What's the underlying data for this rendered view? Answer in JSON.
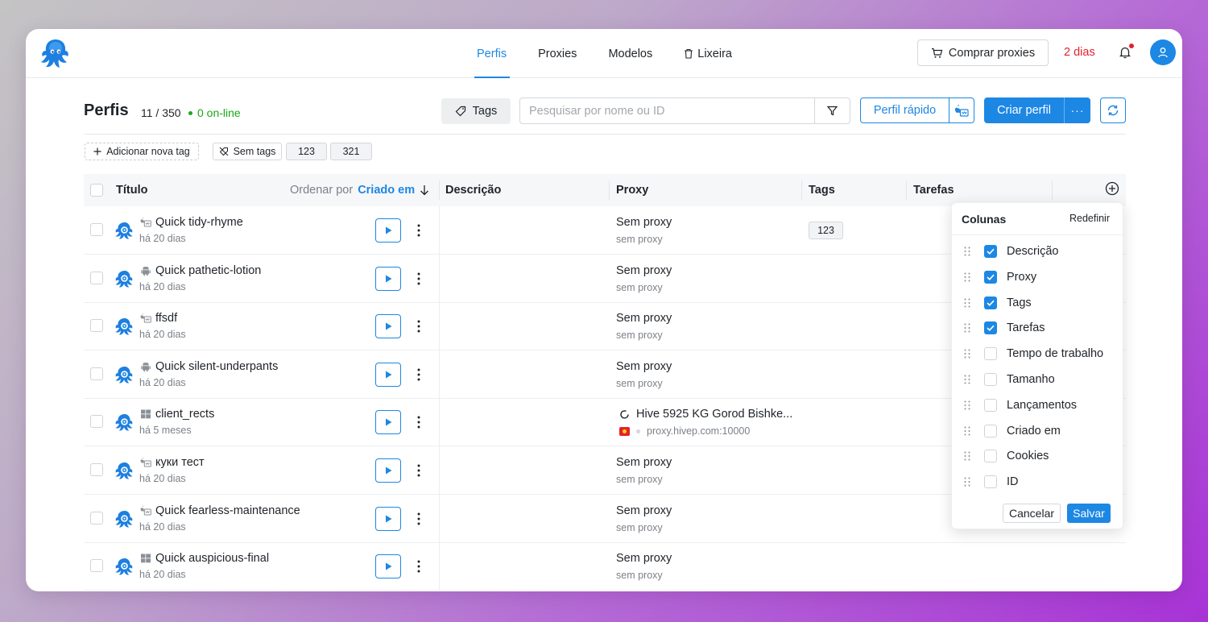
{
  "nav": {
    "items": [
      "Perfis",
      "Proxies",
      "Modelos",
      "Lixeira"
    ],
    "active": "Perfis",
    "buy_label": "Comprar proxies",
    "days_left": "2 dias"
  },
  "header": {
    "title": "Perfis",
    "count": "11 / 350",
    "online": "0 on-line",
    "tags_label": "Tags",
    "search_placeholder": "Pesquisar por nome ou ID",
    "quick_profile_label": "Perfil rápido",
    "create_label": "Criar perfil",
    "create_more": "···"
  },
  "tag_filters": {
    "add_label": "Adicionar nova tag",
    "no_tags_label": "Sem tags",
    "tags": [
      "123",
      "321"
    ]
  },
  "table": {
    "columns": {
      "title": "Título",
      "sort_prefix": "Ordenar por",
      "sort_value": "Criado em",
      "description": "Descrição",
      "proxy": "Proxy",
      "tags": "Tags",
      "tasks": "Tarefas"
    },
    "rows": [
      {
        "title": "Quick tidy-rhyme",
        "created": "há 20 dias",
        "os": "macos-icon",
        "proxy": "Sem proxy",
        "proxy_sub": "sem proxy",
        "tag": "123"
      },
      {
        "title": "Quick pathetic-lotion",
        "created": "há 20 dias",
        "os": "android-icon",
        "proxy": "Sem proxy",
        "proxy_sub": "sem proxy",
        "tag": ""
      },
      {
        "title": "ffsdf",
        "created": "há 20 dias",
        "os": "macos-icon",
        "proxy": "Sem proxy",
        "proxy_sub": "sem proxy",
        "tag": ""
      },
      {
        "title": "Quick silent-underpants",
        "created": "há 20 dias",
        "os": "android-icon",
        "proxy": "Sem proxy",
        "proxy_sub": "sem proxy",
        "tag": ""
      },
      {
        "title": "client_rects",
        "created": "há 5 meses",
        "os": "windows-icon",
        "proxy": "Hive 5925 KG Gorod Bishke...",
        "proxy_sub": "proxy.hivep.com:10000",
        "tag": ""
      },
      {
        "title": "куки тест",
        "created": "há 20 dias",
        "os": "macos-icon",
        "proxy": "Sem proxy",
        "proxy_sub": "sem proxy",
        "tag": ""
      },
      {
        "title": "Quick fearless-maintenance",
        "created": "há 20 dias",
        "os": "macos-icon",
        "proxy": "Sem proxy",
        "proxy_sub": "sem proxy",
        "tag": ""
      },
      {
        "title": "Quick auspicious-final",
        "created": "há 20 dias",
        "os": "windows-icon",
        "proxy": "Sem proxy",
        "proxy_sub": "sem proxy",
        "tag": ""
      }
    ]
  },
  "columns_popup": {
    "title": "Colunas",
    "reset_label": "Redefinir",
    "items": [
      {
        "label": "Descrição",
        "checked": true
      },
      {
        "label": "Proxy",
        "checked": true
      },
      {
        "label": "Tags",
        "checked": true
      },
      {
        "label": "Tarefas",
        "checked": true
      },
      {
        "label": "Tempo de trabalho",
        "checked": false
      },
      {
        "label": "Tamanho",
        "checked": false
      },
      {
        "label": "Lançamentos",
        "checked": false
      },
      {
        "label": "Criado em",
        "checked": false
      },
      {
        "label": "Cookies",
        "checked": false
      },
      {
        "label": "ID",
        "checked": false
      }
    ],
    "cancel_label": "Cancelar",
    "save_label": "Salvar"
  },
  "colors": {
    "accent": "#1d87e4",
    "danger": "#e5202e",
    "online": "#18a818"
  }
}
